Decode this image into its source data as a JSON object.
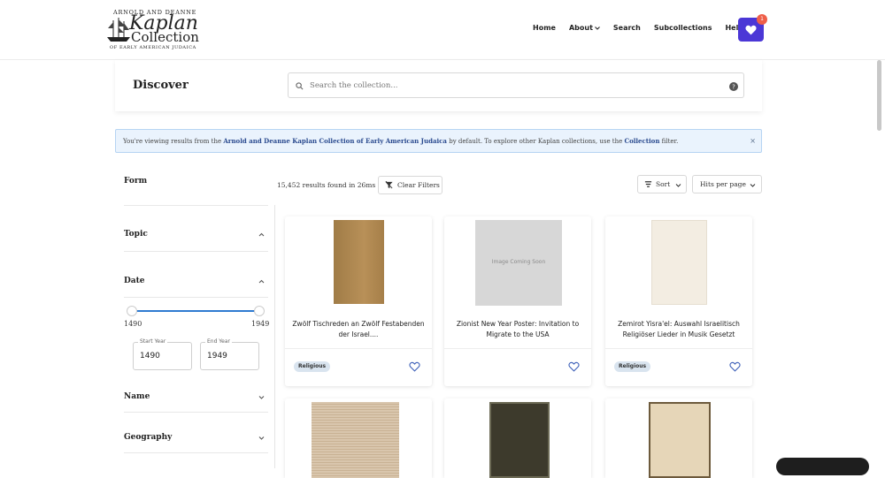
{
  "logo": {
    "line1": "ARNOLD AND DEANNE",
    "line2": "Kaplan",
    "line3": "Collection",
    "line4": "OF EARLY AMERICAN JUDAICA"
  },
  "nav": {
    "home": "Home",
    "about": "About",
    "search": "Search",
    "subcollections": "Subcollections",
    "help": "Help"
  },
  "favorites": {
    "count": "1"
  },
  "discover": {
    "title": "Discover",
    "placeholder": "Search the collection..."
  },
  "info": {
    "pre": "You're viewing results from the ",
    "collection": "Arnold and Deanne Kaplan Collection of Early American Judaica",
    "mid": " by default. To explore other Kaplan collections, use the ",
    "filter": "Collection",
    "post": " filter.",
    "close": "×"
  },
  "facets": {
    "form": "Form",
    "topic": "Topic",
    "date": "Date",
    "name": "Name",
    "geography": "Geography"
  },
  "date_range": {
    "min": "1490",
    "max": "1949",
    "start_label": "Start Year",
    "end_label": "End Year",
    "start_value": "1490",
    "end_value": "1949"
  },
  "results": {
    "count_text": "15,452 results found in 26ms",
    "clear": "Clear Filters",
    "sort": "Sort",
    "hits": "Hits per page"
  },
  "cards": [
    {
      "title": "Zwölf Tischreden an Zwölf Festabenden der Israel....",
      "tag": "Religious",
      "image": "brown-book-cover"
    },
    {
      "title": "Zionist New Year Poster: Invitation to Migrate to the USA",
      "tag": "",
      "image_text": "Image Coming Soon"
    },
    {
      "title": "Zemirot Yisra'el: Auswahl Israelitisch Religiöser Lieder in Musik Gesetzt",
      "tag": "Religious",
      "image": "cream-page"
    }
  ],
  "colors": {
    "accent": "#4b37d6",
    "badge": "#ef5f49",
    "slider": "#2e7ad1",
    "info_bg": "#eaf3fd",
    "tag_bg": "#d9e4ef"
  }
}
